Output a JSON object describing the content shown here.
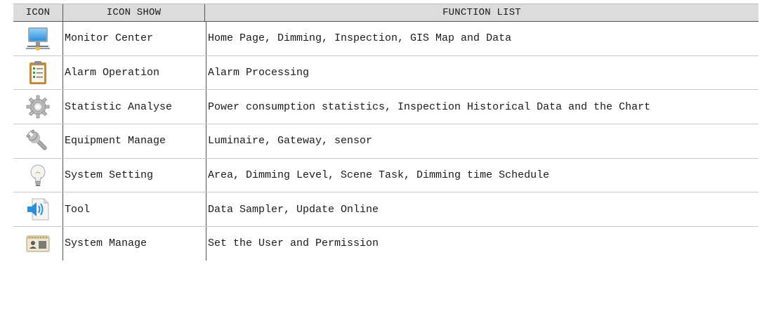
{
  "header": {
    "col_icon": "ICON",
    "col_show": "ICON SHOW",
    "col_functions": "FUNCTION LIST"
  },
  "rows": [
    {
      "icon": "monitor-icon",
      "name": "Monitor Center",
      "functions": "Home Page, Dimming, Inspection, GIS Map and Data"
    },
    {
      "icon": "clipboard-checklist-icon",
      "name": "Alarm Operation",
      "functions": "Alarm Processing"
    },
    {
      "icon": "gear-icon",
      "name": "Statistic Analyse",
      "functions": "Power consumption statistics, Inspection Historical Data and the Chart"
    },
    {
      "icon": "wrench-icon",
      "name": "Equipment Manage",
      "functions": "Luminaire, Gateway, sensor"
    },
    {
      "icon": "lightbulb-icon",
      "name": "System Setting",
      "functions": "Area, Dimming Level, Scene Task, Dimming time Schedule"
    },
    {
      "icon": "speaker-icon",
      "name": "Tool",
      "functions": "Data Sampler, Update Online"
    },
    {
      "icon": "user-card-icon",
      "name": "System Manage",
      "functions": "Set the User and Permission"
    }
  ]
}
